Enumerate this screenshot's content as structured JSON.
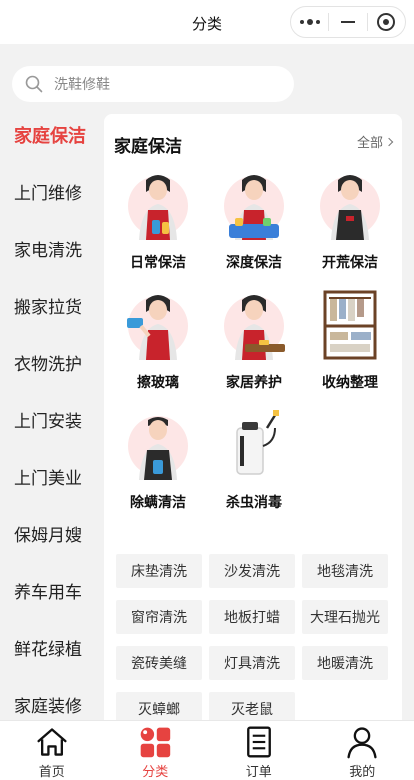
{
  "navbar": {
    "title": "分类",
    "capsule_icons": [
      "more-dots-icon",
      "minimize-icon",
      "close-target-icon"
    ]
  },
  "search": {
    "placeholder": "洗鞋修鞋",
    "icon": "search-icon"
  },
  "sidebar": {
    "items": [
      {
        "label": "家庭保洁",
        "active": true
      },
      {
        "label": "上门维修"
      },
      {
        "label": "家电清洗"
      },
      {
        "label": "搬家拉货"
      },
      {
        "label": "衣物洗护"
      },
      {
        "label": "上门安装"
      },
      {
        "label": "上门美业"
      },
      {
        "label": "保姆月嫂"
      },
      {
        "label": "养车用车"
      },
      {
        "label": "鲜花绿植"
      },
      {
        "label": "家庭装修"
      }
    ]
  },
  "panel": {
    "heading": "家庭保洁",
    "all_link": "全部",
    "services": [
      {
        "label": "日常保洁",
        "icon": "cleaner-with-supplies-icon"
      },
      {
        "label": "深度保洁",
        "icon": "cleaner-with-bucket-icon"
      },
      {
        "label": "开荒保洁",
        "icon": "cleaner-apron-icon"
      },
      {
        "label": "擦玻璃",
        "icon": "cleaner-window-icon"
      },
      {
        "label": "家居养护",
        "icon": "cleaner-furniture-icon"
      },
      {
        "label": "收纳整理",
        "icon": "wardrobe-rack-icon"
      },
      {
        "label": "除螨清洁",
        "icon": "cleaner-male-icon"
      },
      {
        "label": "杀虫消毒",
        "icon": "sprayer-icon"
      }
    ],
    "tags": [
      "床垫清洗",
      "沙发清洗",
      "地毯清洗",
      "窗帘清洗",
      "地板打蜡",
      "大理石抛光",
      "瓷砖美缝",
      "灯具清洗",
      "地暖清洗",
      "灭蟑螂",
      "灭老鼠"
    ]
  },
  "tabbar": {
    "tabs": [
      {
        "label": "首页",
        "icon": "home-icon"
      },
      {
        "label": "分类",
        "icon": "category-icon",
        "active": true
      },
      {
        "label": "订单",
        "icon": "order-icon"
      },
      {
        "label": "我的",
        "icon": "profile-icon"
      }
    ]
  },
  "colors": {
    "accent": "#e64340",
    "apron": "#c8232c",
    "background": "#f2f2f2"
  }
}
